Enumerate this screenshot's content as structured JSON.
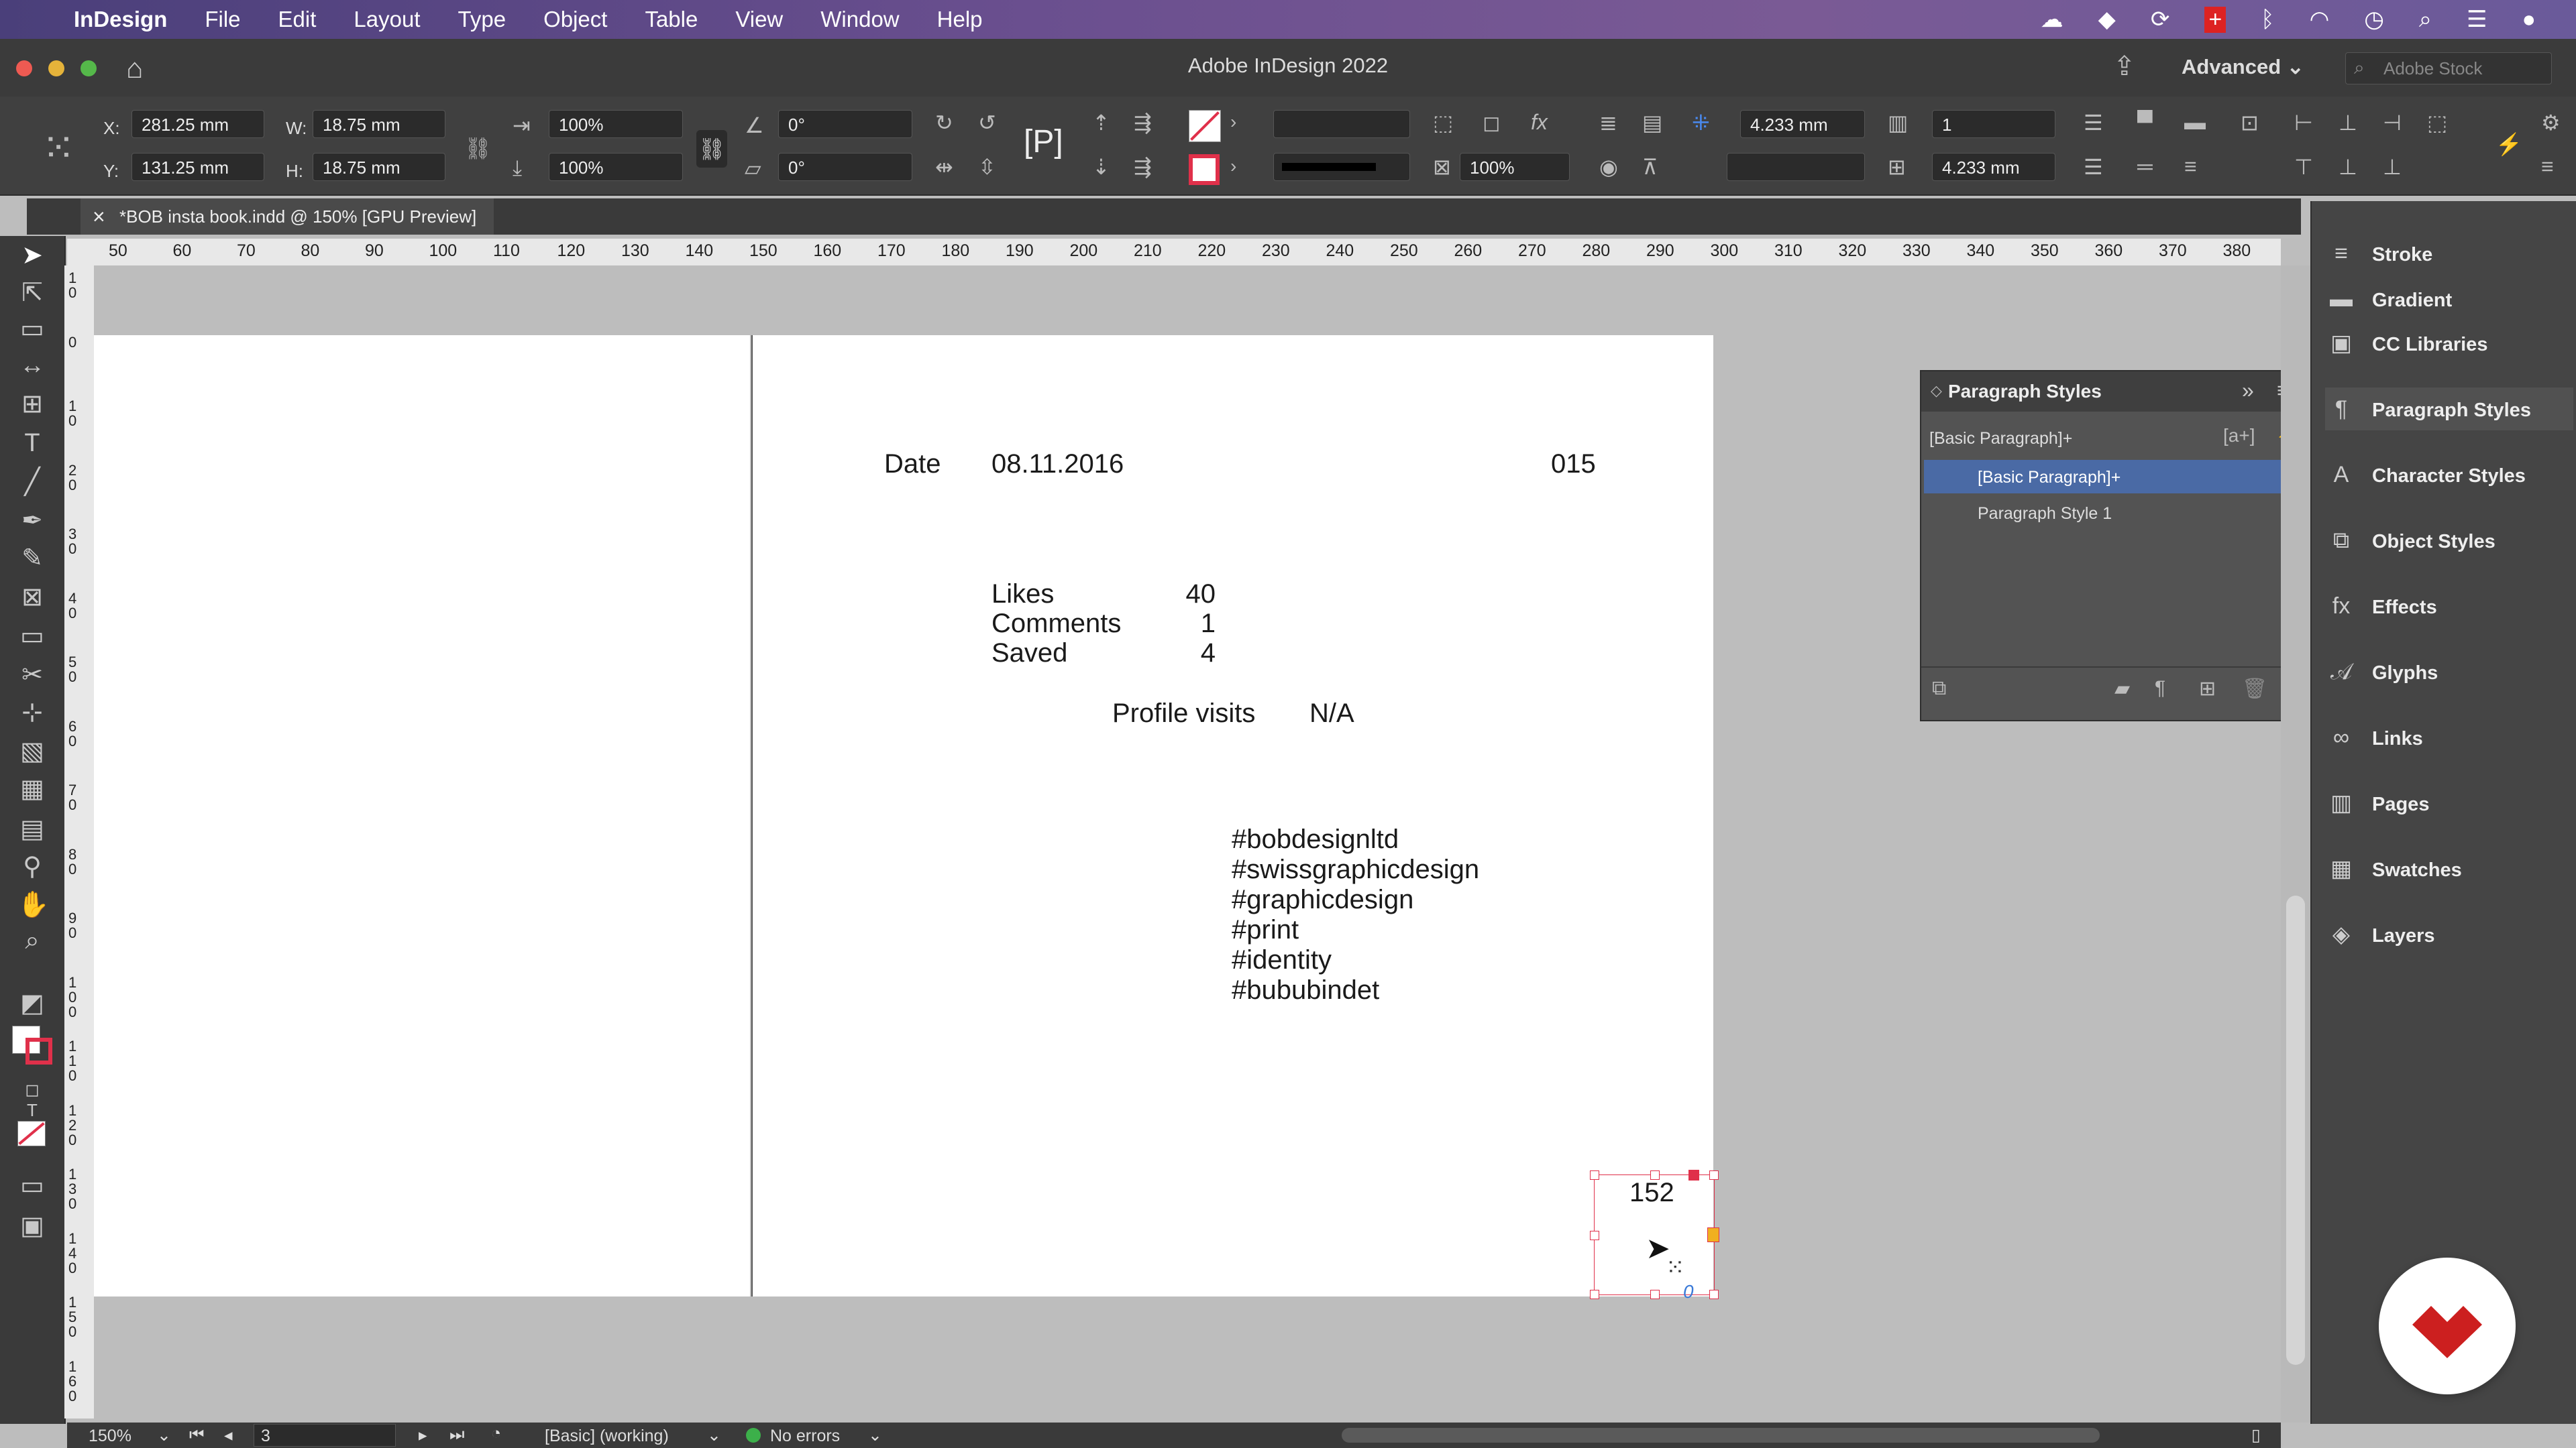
{
  "menubar": {
    "app_name": "InDesign",
    "items": [
      "File",
      "Edit",
      "Layout",
      "Type",
      "Object",
      "Table",
      "View",
      "Window",
      "Help"
    ]
  },
  "window": {
    "title": "Adobe InDesign 2022",
    "workspace": "Advanced",
    "stock_search_placeholder": "Adobe Stock"
  },
  "control": {
    "x": "281.25 mm",
    "y": "131.25 mm",
    "w": "18.75 mm",
    "h": "18.75 mm",
    "scale_x": "100%",
    "scale_y": "100%",
    "rotate": "0°",
    "shear": "0°",
    "opacity": "100%",
    "spacing_1": "4.233 mm",
    "spacing_2": "4.233 mm",
    "columns": "1",
    "x_label": "X:",
    "y_label": "Y:",
    "w_label": "W:",
    "h_label": "H:"
  },
  "document_tab": {
    "label": "*BOB insta book.indd @ 150% [GPU Preview]",
    "close": "×"
  },
  "ruler": {
    "h_ticks": [
      "50",
      "60",
      "70",
      "80",
      "90",
      "100",
      "110",
      "120",
      "130",
      "140",
      "150",
      "160",
      "170",
      "180",
      "190",
      "200",
      "210",
      "220",
      "230",
      "240",
      "250",
      "260",
      "270",
      "280",
      "290",
      "300",
      "310",
      "320",
      "330",
      "340",
      "350",
      "360",
      "370",
      "380"
    ],
    "v_ticks": [
      "10",
      "0",
      "10",
      "20",
      "30",
      "40",
      "50",
      "60",
      "70",
      "80",
      "90",
      "100",
      "110",
      "120",
      "130",
      "140",
      "150",
      "160"
    ]
  },
  "page": {
    "date_label": "Date",
    "date_value": "08.11.2016",
    "number": "015",
    "likes_label": "Likes",
    "likes_value": "40",
    "comments_label": "Comments",
    "comments_value": "1",
    "saved_label": "Saved",
    "saved_value": "4",
    "profile_label": "Profile visits",
    "profile_value": "N/A",
    "hashtags": [
      "#bobdesignltd",
      "#swissgraphicdesign",
      "#graphicdesign",
      "#print",
      "#identity",
      "#bububindet"
    ],
    "frame_text": "152"
  },
  "paragraph_styles_panel": {
    "title": "Paragraph Styles",
    "current": "[Basic Paragraph]+",
    "styles": [
      "[Basic Paragraph]+",
      "Paragraph Style 1"
    ]
  },
  "dock": {
    "items": [
      {
        "label": "Stroke",
        "icon": "stroke-icon"
      },
      {
        "label": "Gradient",
        "icon": "gradient-icon"
      },
      {
        "label": "CC Libraries",
        "icon": "cc-libraries-icon"
      },
      {
        "label": "Paragraph Styles",
        "icon": "paragraph-styles-icon"
      },
      {
        "label": "Character Styles",
        "icon": "character-styles-icon"
      },
      {
        "label": "Object Styles",
        "icon": "object-styles-icon"
      },
      {
        "label": "Effects",
        "icon": "effects-icon"
      },
      {
        "label": "Glyphs",
        "icon": "glyphs-icon"
      },
      {
        "label": "Links",
        "icon": "links-icon"
      },
      {
        "label": "Pages",
        "icon": "pages-icon"
      },
      {
        "label": "Swatches",
        "icon": "swatches-icon"
      },
      {
        "label": "Layers",
        "icon": "layers-icon"
      }
    ]
  },
  "status": {
    "zoom": "150%",
    "page": "3",
    "style": "[Basic] (working)",
    "preflight": "No errors"
  },
  "colors": {
    "menubar": "#5a4a8a",
    "panel": "#454545",
    "selection": "#4a6aa5",
    "frame_handle": "#e0304a",
    "badge": "#cc1f1f"
  }
}
